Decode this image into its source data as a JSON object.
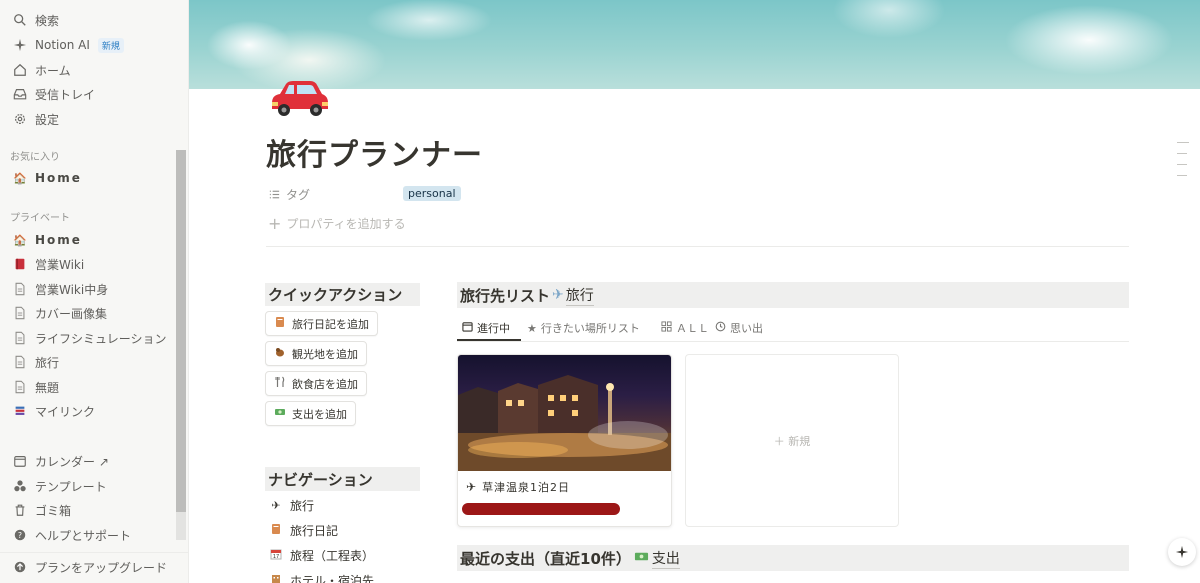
{
  "sidebar": {
    "top_items": [
      {
        "label": "検索",
        "icon": "search-icon"
      },
      {
        "label": "Notion AI",
        "icon": "sparkle-icon",
        "badge": "新規"
      },
      {
        "label": "ホーム",
        "icon": "home-icon"
      },
      {
        "label": "受信トレイ",
        "icon": "inbox-icon"
      },
      {
        "label": "設定",
        "icon": "gear-icon"
      }
    ],
    "favorites_label": "お気に入り",
    "favorites": [
      {
        "label": "Home",
        "icon": "house-emoji-icon"
      }
    ],
    "private_label": "プライベート",
    "private_items": [
      {
        "label": "Home",
        "icon": "house-emoji-icon"
      },
      {
        "label": "営業Wiki",
        "icon": "red-book-icon"
      },
      {
        "label": "営業Wiki中身",
        "icon": "page-icon"
      },
      {
        "label": "カバー画像集",
        "icon": "page-icon"
      },
      {
        "label": "ライフシミュレーション",
        "icon": "page-icon"
      },
      {
        "label": "旅行",
        "icon": "page-icon"
      },
      {
        "label": "無題",
        "icon": "page-icon"
      },
      {
        "label": "マイリンク",
        "icon": "books-icon"
      }
    ],
    "tool_items": [
      {
        "label": "カレンダー ↗",
        "icon": "calendar-icon"
      },
      {
        "label": "テンプレート",
        "icon": "shapes-icon"
      },
      {
        "label": "ゴミ箱",
        "icon": "trash-icon"
      },
      {
        "label": "ヘルプとサポート",
        "icon": "help-icon"
      }
    ],
    "upgrade_label": "プランをアップグレード"
  },
  "page": {
    "title": "旅行プランナー",
    "property_label": "タグ",
    "tag_value": "personal",
    "add_property": "プロパティを追加する"
  },
  "quick_actions": {
    "heading": "クイックアクション",
    "buttons": [
      {
        "label": "旅行日記を追加",
        "icon": "notebook-icon"
      },
      {
        "label": "観光地を追加",
        "icon": "chipmunk-icon"
      },
      {
        "label": "飲食店を追加",
        "icon": "fork-knife-icon"
      },
      {
        "label": "支出を追加",
        "icon": "money-icon"
      }
    ]
  },
  "navigation": {
    "heading": "ナビゲーション",
    "items": [
      {
        "label": "旅行",
        "icon": "airplane-icon"
      },
      {
        "label": "旅行日記",
        "icon": "notebook-icon"
      },
      {
        "label": "旅程（工程表）",
        "icon": "calendar-icon"
      },
      {
        "label": "ホテル・宿泊先",
        "icon": "hotel-icon"
      }
    ]
  },
  "travel_list": {
    "heading": "旅行先リスト",
    "link_label": "旅行",
    "tabs": [
      {
        "label": "進行中",
        "icon": "calendar-icon",
        "active": true
      },
      {
        "label": "行きたい場所リスト",
        "icon": "star-icon",
        "active": false
      },
      {
        "label": "ＡＬＬ",
        "icon": "grid-icon",
        "active": false
      },
      {
        "label": "思い出",
        "icon": "clock-icon",
        "active": false
      }
    ],
    "cards": [
      {
        "title": "草津温泉1泊2日",
        "icon": "airplane-icon"
      }
    ],
    "new_label": "＋ 新規"
  },
  "expenses": {
    "heading": "最近の支出（直近10件）",
    "link_label": "支出"
  },
  "colors": {
    "tag_bg": "#d3e5ef",
    "redaction": "#9c1717",
    "sidebar_bg": "#f7f7f5"
  }
}
